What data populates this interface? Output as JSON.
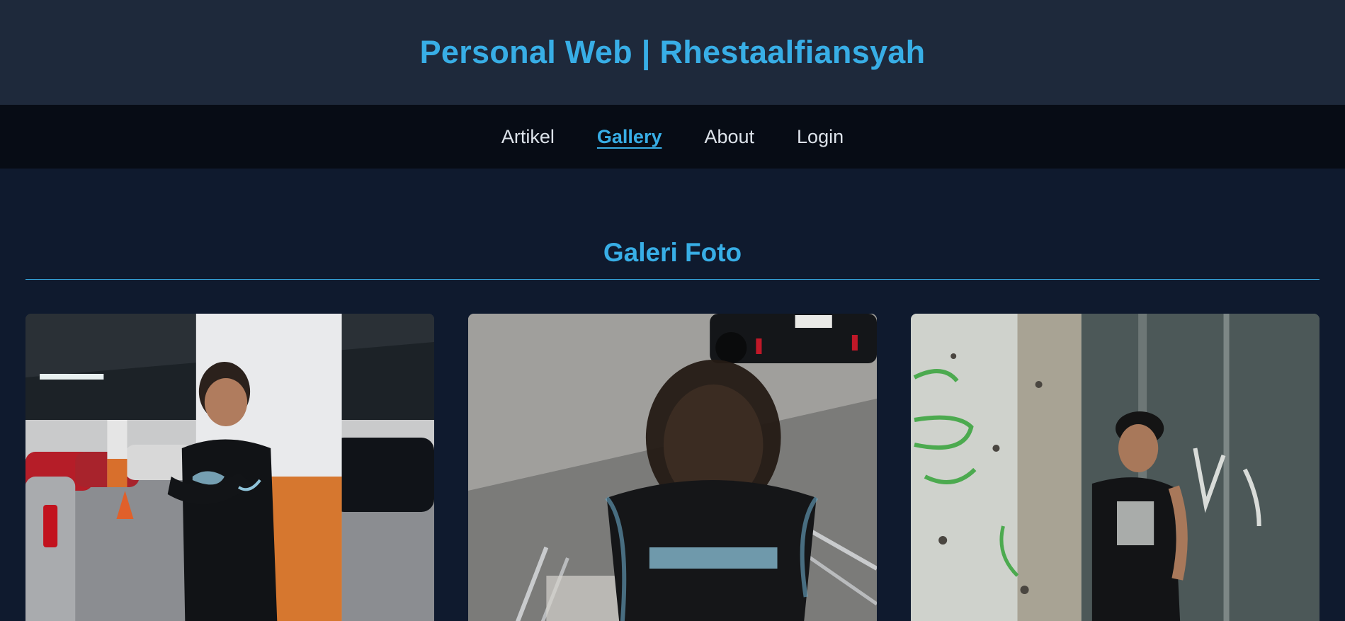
{
  "header": {
    "title": "Personal Web | Rhestaalfiansyah"
  },
  "nav": {
    "items": [
      {
        "label": "Artikel",
        "active": false
      },
      {
        "label": "Gallery",
        "active": true
      },
      {
        "label": "About",
        "active": false
      },
      {
        "label": "Login",
        "active": false
      }
    ]
  },
  "gallery": {
    "heading": "Galeri Foto",
    "photos": [
      {
        "subject": "man-in-parking-garage-photo"
      },
      {
        "subject": "blurred-man-on-stairs-photo"
      },
      {
        "subject": "man-by-graffiti-wall-photo"
      }
    ]
  },
  "colors": {
    "header_bg": "#1e293b",
    "nav_bg": "#070c15",
    "page_bg": "#0f1a2e",
    "accent": "#38aee6",
    "nav_text": "#dde3ea"
  }
}
